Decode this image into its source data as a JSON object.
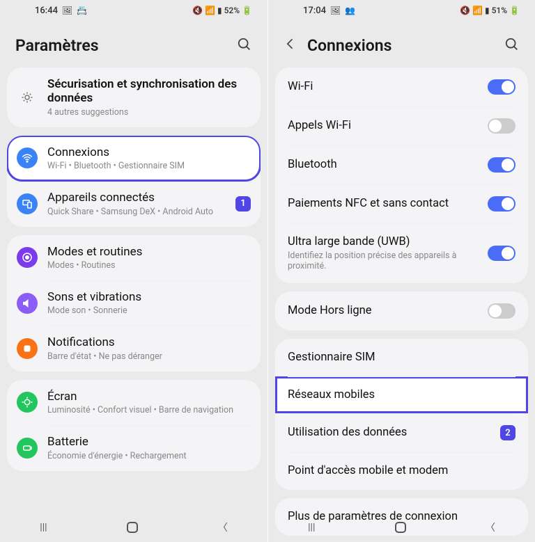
{
  "left": {
    "status": {
      "time": "16:44",
      "battery": "52%",
      "icons": [
        "🖼",
        "📇"
      ]
    },
    "header": {
      "title": "Paramètres"
    },
    "tip": {
      "title": "Sécurisation et synchronisation des données",
      "sub": "4 autres suggestions"
    },
    "g1": [
      {
        "id": "connexions",
        "title": "Connexions",
        "sub": "Wi-Fi  •  Bluetooth  •  Gestionnaire SIM",
        "hl": true
      },
      {
        "id": "appareils",
        "title": "Appareils connectés",
        "sub": "Quick Share  •  Samsung DeX  •  Android Auto",
        "badge": "1"
      }
    ],
    "g2": [
      {
        "id": "modes",
        "title": "Modes et routines",
        "sub": "Modes  •  Routines"
      },
      {
        "id": "sons",
        "title": "Sons et vibrations",
        "sub": "Mode son  •  Sonnerie"
      },
      {
        "id": "notif",
        "title": "Notifications",
        "sub": "Barre d'état  •  Ne pas déranger"
      }
    ],
    "g3": [
      {
        "id": "ecran",
        "title": "Écran",
        "sub": "Luminosité  •  Confort visuel  •  Barre de navigation"
      },
      {
        "id": "batterie",
        "title": "Batterie",
        "sub": "Économie d'énergie  •  Rechargement"
      }
    ]
  },
  "right": {
    "status": {
      "time": "17:04",
      "battery": "51%",
      "icons": [
        "🖼",
        "👥"
      ]
    },
    "header": {
      "title": "Connexions"
    },
    "g1": [
      {
        "id": "wifi",
        "title": "Wi-Fi",
        "toggle": "on"
      },
      {
        "id": "appels",
        "title": "Appels Wi-Fi",
        "toggle": "off"
      },
      {
        "id": "bt",
        "title": "Bluetooth",
        "toggle": "on"
      },
      {
        "id": "nfc",
        "title": "Paiements NFC et sans contact",
        "toggle": "on"
      },
      {
        "id": "uwb",
        "title": "Ultra large bande (UWB)",
        "sub": "Identifiez la position précise des appareils à proximité.",
        "toggle": "on"
      }
    ],
    "g2": [
      {
        "id": "avion",
        "title": "Mode Hors ligne",
        "toggle": "off"
      }
    ],
    "g3": [
      {
        "id": "sim",
        "title": "Gestionnaire SIM"
      },
      {
        "id": "reseaux",
        "title": "Réseaux mobiles",
        "hl": true
      },
      {
        "id": "data",
        "title": "Utilisation des données",
        "badge": "2"
      },
      {
        "id": "hotspot",
        "title": "Point d'accès mobile et modem"
      }
    ],
    "g4": [
      {
        "id": "more",
        "title": "Plus de paramètres de connexion"
      }
    ]
  }
}
